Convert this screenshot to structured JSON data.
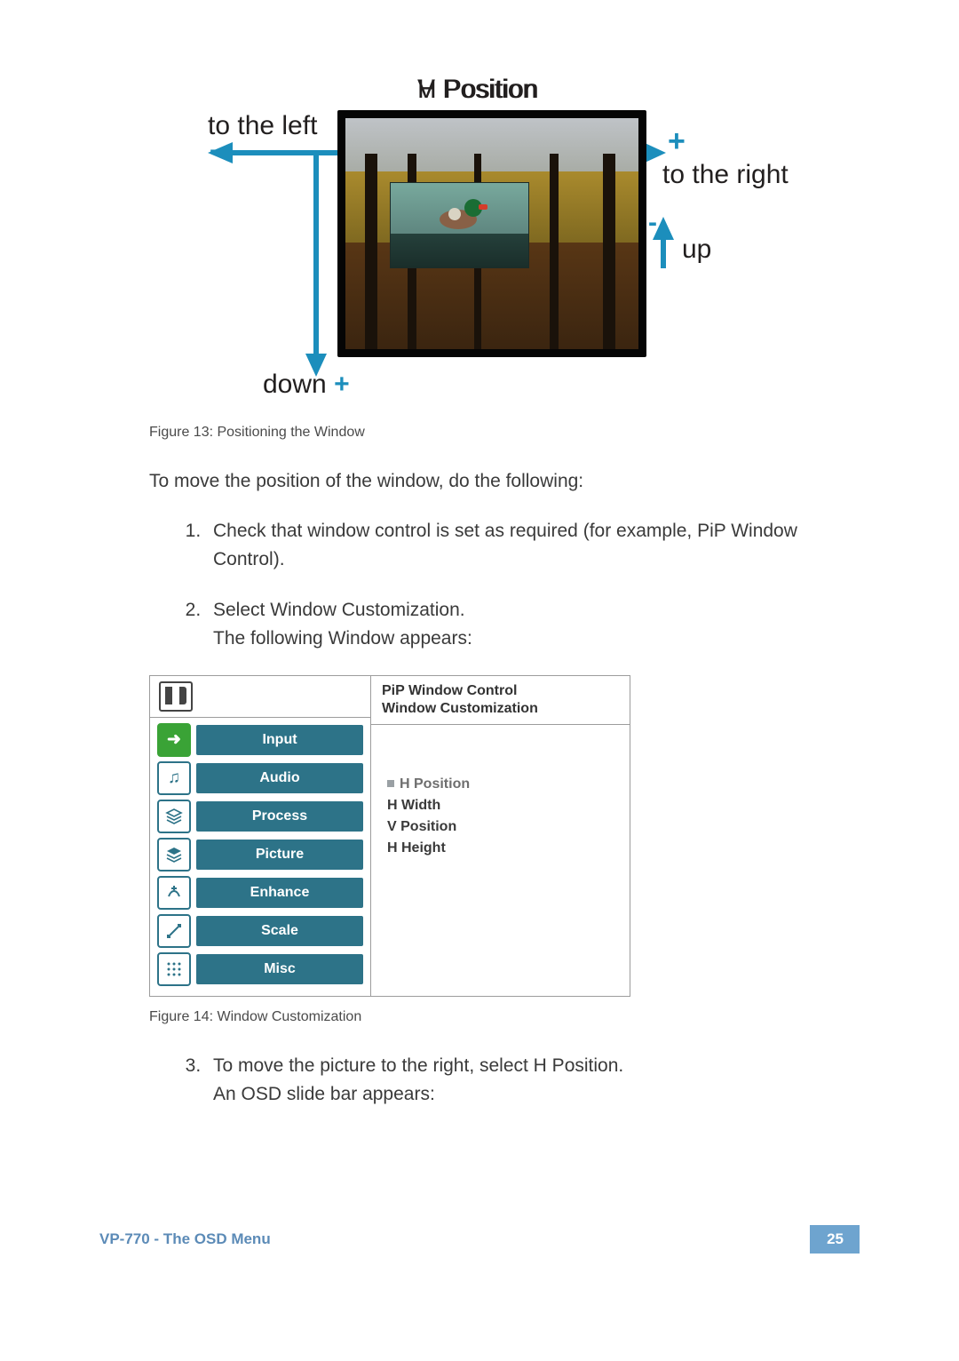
{
  "figure13": {
    "title_h": "H Position",
    "title_v": "V Position",
    "left_label": "to the left",
    "right_label": "to the right",
    "up_label": "up",
    "down_label": "down",
    "caption": "Figure 13: Positioning the Window"
  },
  "body": {
    "intro": "To move the position of the window, do the following:",
    "step1": "Check that window control is set as required (for example, PiP Window Control).",
    "step2a": "Select Window Customization.",
    "step2b": "The following Window appears:",
    "step3a": "To move the picture to the right, select H Position.",
    "step3b": "An OSD slide bar appears:"
  },
  "osd": {
    "header_line1": "PiP Window Control",
    "header_line2": "Window Customization",
    "menu": [
      "Input",
      "Audio",
      "Process",
      "Picture",
      "Enhance",
      "Scale",
      "Misc"
    ],
    "options": [
      "H Position",
      "H Width",
      "V Position",
      "H Height"
    ]
  },
  "figure14_caption": "Figure 14: Window Customization",
  "footer": {
    "text": "VP-770 - The OSD Menu",
    "page": "25"
  }
}
